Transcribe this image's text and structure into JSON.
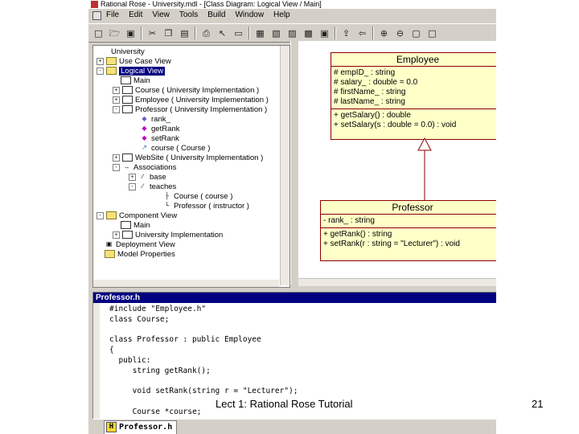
{
  "window": {
    "title": "Rational Rose - University.mdl - [Class Diagram: Logical View / Main]"
  },
  "menu": [
    "File",
    "Edit",
    "View",
    "Tools",
    "Build",
    "Window",
    "Help"
  ],
  "toolbar_icons": [
    "new-icon",
    "open-icon",
    "save-icon",
    "cut-icon",
    "copy-icon",
    "paste-icon",
    "print-icon",
    "context-help-icon",
    "browse-icon",
    "class-diagram-icon",
    "interaction-icon",
    "component-icon",
    "deployment-icon",
    "state-icon",
    "browse-parent-icon",
    "previous-icon",
    "zoom-in-icon",
    "zoom-out-icon",
    "fit-window-icon",
    "undo-fit-icon"
  ],
  "tree": {
    "root": "University",
    "use_case_view": "Use Case View",
    "logical_view": "Logical View",
    "main": "Main",
    "course": "Course ( University Implementation )",
    "employee": "Employee ( University Implementation )",
    "professor": "Professor ( University Implementation )",
    "rank": "rank_",
    "getrank": "getRank",
    "setrank": "setRank",
    "course_role": "course ( Course )",
    "website": "WebSite ( University Implementation )",
    "associations": "Associations",
    "assoc_base": "base",
    "assoc_teaches": "teaches",
    "role_course": "Course ( course )",
    "role_professor": "Professor ( instructor )",
    "component_view": "Component View",
    "comp_main": "Main",
    "comp_impl": "University Implementation",
    "deployment_view": "Deployment View",
    "model_properties": "Model Properties"
  },
  "diagram": {
    "employee": {
      "name": "Employee",
      "attributes": [
        "# empID_ : string",
        "# salary_ : double = 0.0",
        "# firstName_ : string",
        "# lastName_ : string"
      ],
      "operations": [
        "+ getSalary() : double",
        "+ setSalary(s : double = 0.0) : void"
      ]
    },
    "professor": {
      "name": "Professor",
      "attributes": [
        "- rank_ : string"
      ],
      "operations": [
        "+ getRank() : string",
        "+ setRank(r : string = \"Lecturer\") : void"
      ]
    }
  },
  "editor": {
    "title": "Professor.h",
    "code": "#include \"Employee.h\"\nclass Course;\n\nclass Professor : public Employee\n{\n  public:\n     string getRank();\n\n     void setRank(string r = \"Lecturer\");\n\n     Course *course;",
    "tab": "Professor.h"
  },
  "slide": {
    "caption": "Lect 1: Rational Rose Tutorial",
    "page": "21"
  }
}
